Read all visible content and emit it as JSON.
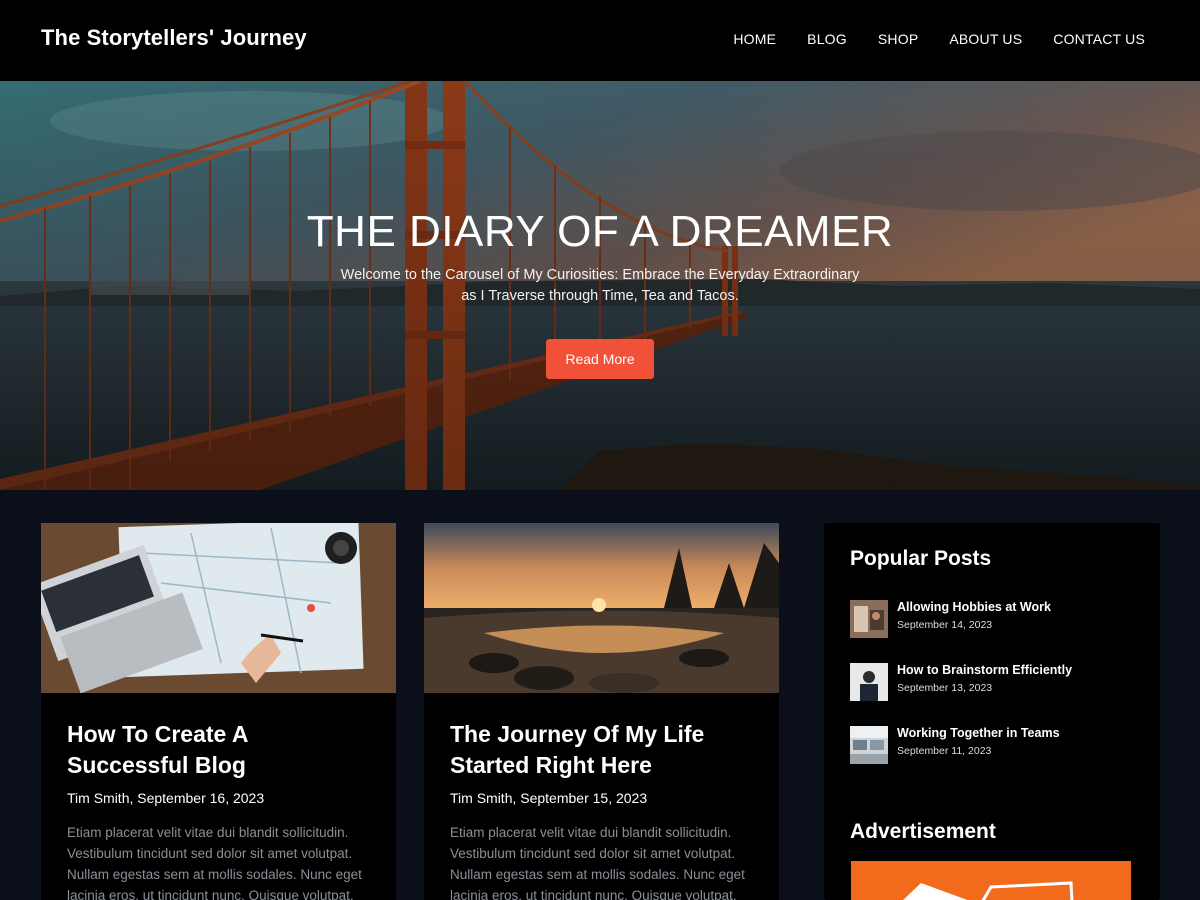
{
  "site": {
    "title": "The Storytellers' Journey"
  },
  "nav": {
    "items": [
      "HOME",
      "BLOG",
      "SHOP",
      "ABOUT US",
      "CONTACT US"
    ]
  },
  "hero": {
    "title": "THE DIARY OF A DREAMER",
    "subtitle_line1": "Welcome to the Carousel of My Curiosities: Embrace the Everyday Extraordinary",
    "subtitle_line2": "as I Traverse through Time, Tea and Tacos.",
    "button": "Read More"
  },
  "posts": [
    {
      "title_line1": "How To Create A",
      "title_line2": "Successful Blog",
      "meta": "Tim Smith, September 16, 2023",
      "excerpt": [
        "Etiam placerat velit vitae dui blandit sollicitudin.",
        "Vestibulum tincidunt sed dolor sit amet volutpat.",
        "Nullam egestas sem at mollis sodales. Nunc eget",
        "lacinia eros, ut tincidunt nunc. Quisque volutpat,"
      ]
    },
    {
      "title_line1": "The Journey Of My Life",
      "title_line2": "Started Right Here",
      "meta": "Tim Smith, September 15, 2023",
      "excerpt": [
        "Etiam placerat velit vitae dui blandit sollicitudin.",
        "Vestibulum tincidunt sed dolor sit amet volutpat.",
        "Nullam egestas sem at mollis sodales. Nunc eget",
        "lacinia eros, ut tincidunt nunc. Quisque volutpat,"
      ]
    }
  ],
  "sidebar": {
    "popular_heading": "Popular Posts",
    "popular": [
      {
        "title": "Allowing Hobbies at Work",
        "date": "September 14, 2023"
      },
      {
        "title": "How to Brainstorm Efficiently",
        "date": "September 13, 2023"
      },
      {
        "title": "Working Together in Teams",
        "date": "September 11, 2023"
      }
    ],
    "ad_heading": "Advertisement"
  },
  "colors": {
    "accent": "#f05138",
    "page_bg": "#0a0f1a",
    "card_bg": "#000000",
    "ad_bg": "#f26b1d"
  }
}
